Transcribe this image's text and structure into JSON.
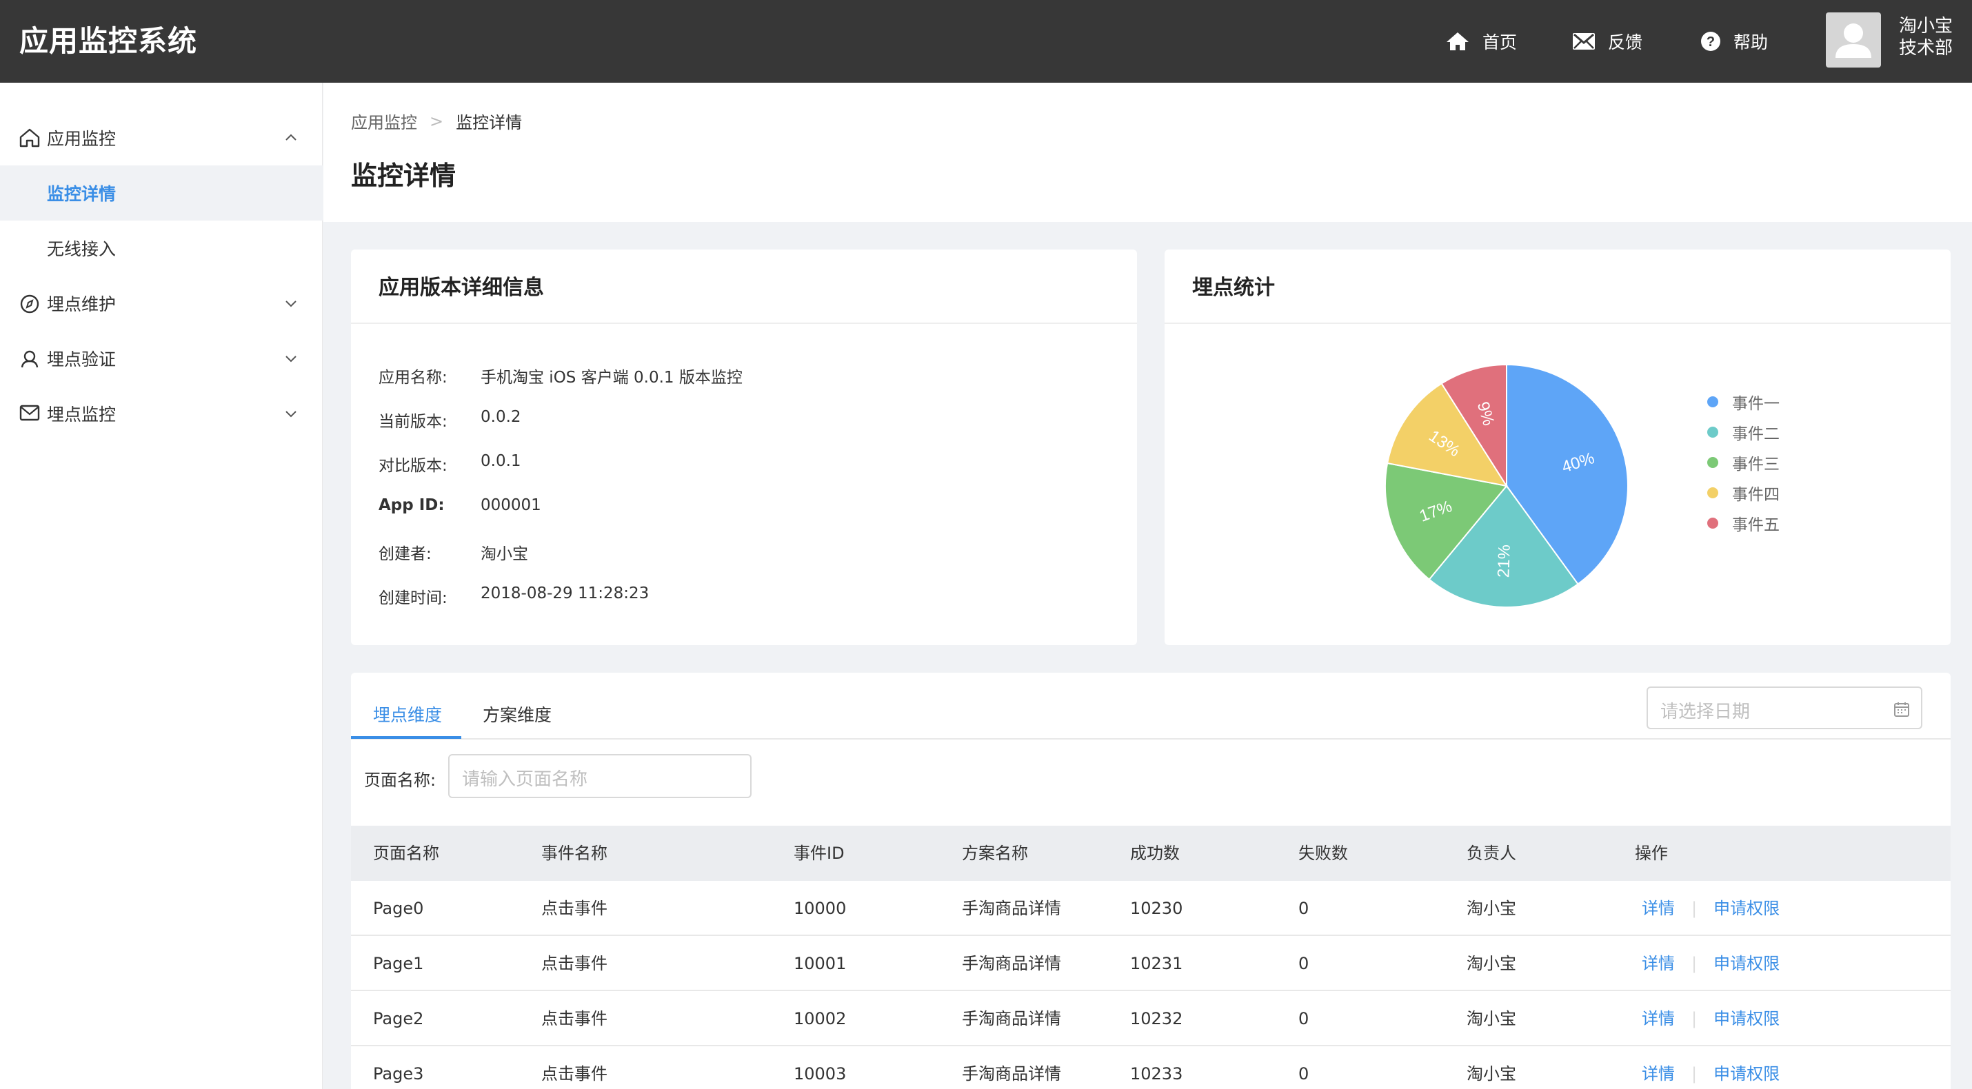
{
  "app_title": "应用监控系统",
  "header": {
    "nav": [
      {
        "label": "首页",
        "icon": "home-icon"
      },
      {
        "label": "反馈",
        "icon": "mail-icon"
      },
      {
        "label": "帮助",
        "icon": "help-icon"
      }
    ],
    "user": {
      "name": "淘小宝",
      "dept": "技术部"
    }
  },
  "sidebar": {
    "items": [
      {
        "label": "应用监控",
        "icon": "home-icon",
        "expanded": true,
        "children": [
          {
            "label": "监控详情",
            "active": true
          },
          {
            "label": "无线接入",
            "active": false
          }
        ]
      },
      {
        "label": "埋点维护",
        "icon": "compass-icon",
        "expanded": false
      },
      {
        "label": "埋点验证",
        "icon": "user-icon",
        "expanded": false
      },
      {
        "label": "埋点监控",
        "icon": "mail-icon",
        "expanded": false
      }
    ]
  },
  "breadcrumb": {
    "parent": "应用监控",
    "separator": ">",
    "current": "监控详情"
  },
  "page_title": "监控详情",
  "info_card": {
    "title": "应用版本详细信息",
    "rows": [
      {
        "key": "应用名称:",
        "value": "手机淘宝 iOS 客户端 0.0.1 版本监控"
      },
      {
        "key": "当前版本:",
        "value": "0.0.2"
      },
      {
        "key": "对比版本:",
        "value": "0.0.1"
      },
      {
        "key": "App ID:",
        "value": "000001"
      },
      {
        "key": "创建者:",
        "value": "淘小宝"
      },
      {
        "key": "创建时间:",
        "value": "2018-08-29 11:28:23"
      }
    ]
  },
  "stats_card": {
    "title": "埋点统计"
  },
  "chart_data": {
    "type": "pie",
    "title": "",
    "categories": [
      "事件一",
      "事件二",
      "事件三",
      "事件四",
      "事件五"
    ],
    "values": [
      40,
      21,
      17,
      13,
      9
    ],
    "labels": [
      "40%",
      "21%",
      "17%",
      "13%",
      "9%"
    ],
    "colors": [
      "#5ea5f7",
      "#6dcbc9",
      "#7cc976",
      "#f3d067",
      "#e0707c"
    ],
    "legend_position": "right"
  },
  "tabs": [
    {
      "label": "埋点维度",
      "active": true
    },
    {
      "label": "方案维度",
      "active": false
    }
  ],
  "date_picker": {
    "placeholder": "请选择日期"
  },
  "filter": {
    "label": "页面名称:",
    "placeholder": "请输入页面名称"
  },
  "table": {
    "columns": [
      "页面名称",
      "事件名称",
      "事件ID",
      "方案名称",
      "成功数",
      "失败数",
      "负责人",
      "操作"
    ],
    "rows": [
      [
        "Page0",
        "点击事件",
        "10000",
        "手淘商品详情",
        "10230",
        "0",
        "淘小宝"
      ],
      [
        "Page1",
        "点击事件",
        "10001",
        "手淘商品详情",
        "10231",
        "0",
        "淘小宝"
      ],
      [
        "Page2",
        "点击事件",
        "10002",
        "手淘商品详情",
        "10232",
        "0",
        "淘小宝"
      ],
      [
        "Page3",
        "点击事件",
        "10003",
        "手淘商品详情",
        "10233",
        "0",
        "淘小宝"
      ]
    ],
    "actions": [
      "详情",
      "申请权限"
    ],
    "action_separator": "|"
  }
}
